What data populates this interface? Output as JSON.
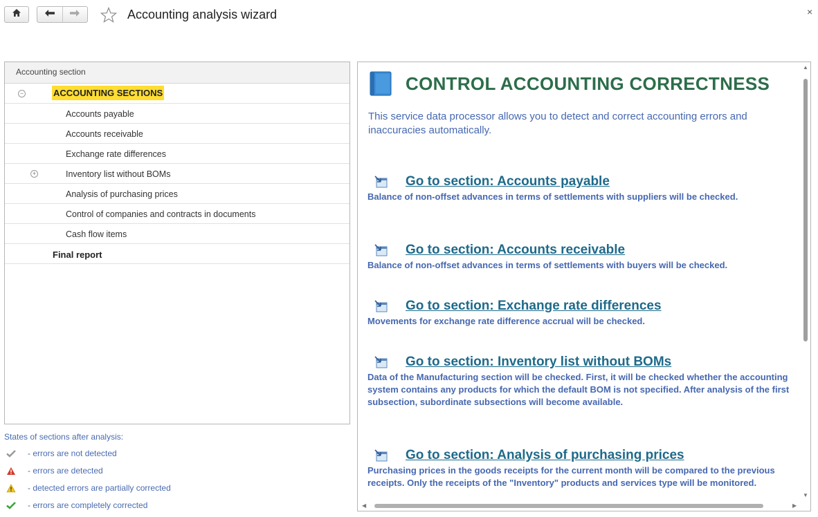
{
  "window": {
    "title": "Accounting analysis wizard",
    "close_symbol": "×"
  },
  "tree": {
    "column_header": "Accounting section",
    "root": {
      "label": "ACCOUNTING SECTIONS",
      "expanded": true
    },
    "items": [
      {
        "label": "Accounts payable",
        "expandable": false
      },
      {
        "label": "Accounts receivable",
        "expandable": false
      },
      {
        "label": "Exchange rate differences",
        "expandable": false
      },
      {
        "label": "Inventory list without BOMs",
        "expandable": true
      },
      {
        "label": "Analysis of purchasing prices",
        "expandable": false
      },
      {
        "label": "Control of companies  and contracts in documents",
        "expandable": false
      },
      {
        "label": "Cash flow items",
        "expandable": false
      }
    ],
    "final": {
      "label": "Final report"
    }
  },
  "legend": {
    "title": "States of sections after analysis:",
    "items": [
      {
        "icon": "gray-check-icon",
        "text": "- errors are not detected"
      },
      {
        "icon": "red-warning-icon",
        "text": "- errors are detected"
      },
      {
        "icon": "yellow-warning-icon",
        "text": "- detected errors are partially corrected"
      },
      {
        "icon": "green-check-icon",
        "text": "- errors are completely corrected"
      }
    ]
  },
  "content": {
    "heading": "CONTROL ACCOUNTING CORRECTNESS",
    "intro": "This service data processor allows you to detect and correct accounting errors and inaccuracies automatically.",
    "sections": [
      {
        "link": "Go to section: Accounts payable",
        "description": "Balance of non-offset advances in terms of settlements with suppliers will be checked."
      },
      {
        "link": "Go to section: Accounts receivable",
        "description": "Balance of non-offset advances in terms of settlements with buyers will be checked."
      },
      {
        "link": "Go to section: Exchange rate differences",
        "description": "Movements for exchange rate difference accrual will be checked."
      },
      {
        "link": "Go to section: Inventory list without BOMs",
        "description": "Data of the Manufacturing section will be checked. First, it will be checked whether the accounting system contains any products for which the default BOM is not specified. After analysis of the first subsection, subordinate subsections will become available."
      },
      {
        "link": "Go to section: Analysis of purchasing prices",
        "description": "Purchasing prices in the goods receipts for the current month will be compared to the previous receipts. Only the receipts of the \"Inventory\" products and services type will be monitored."
      }
    ]
  },
  "colors": {
    "heading": "#2c6d4a",
    "link": "#1e6a8a",
    "text_blue": "#4668b0",
    "highlight": "#ffdd33"
  }
}
